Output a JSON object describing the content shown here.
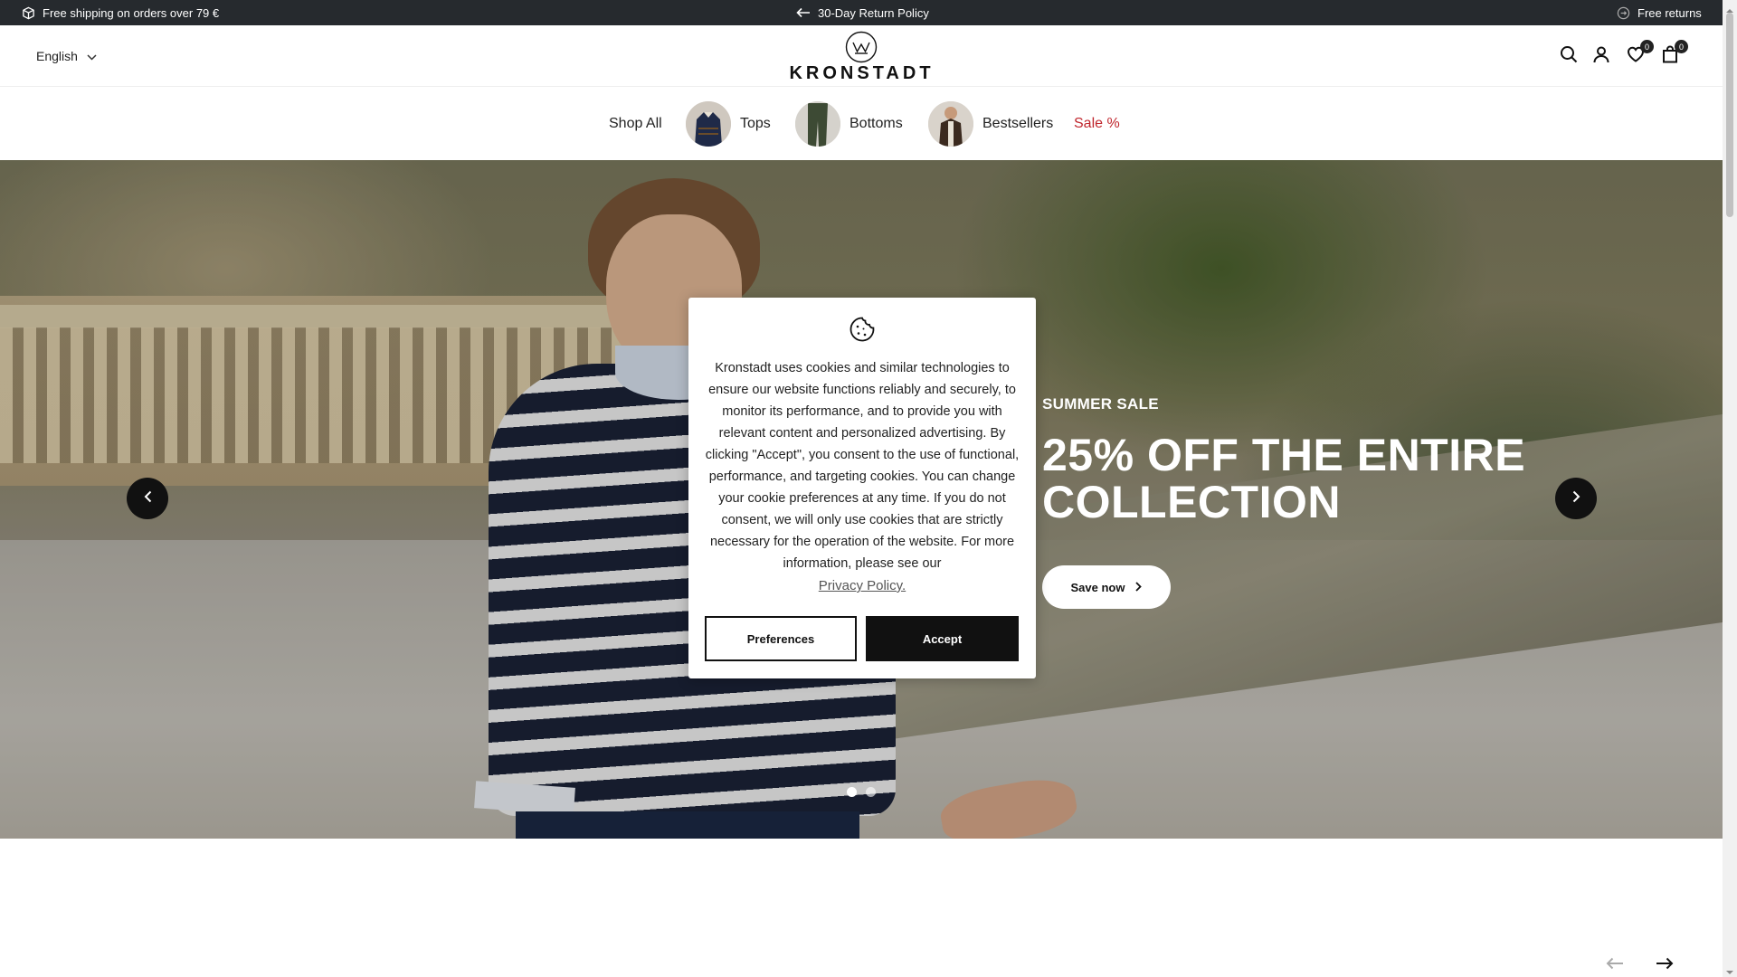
{
  "announcement": {
    "shipping": "Free shipping on orders over 79 €",
    "returns_policy": "30-Day Return Policy",
    "free_returns": "Free returns"
  },
  "header": {
    "language": "English",
    "brand": "KRONSTADT",
    "wishlist_count": "0",
    "cart_count": "0"
  },
  "nav": {
    "items": [
      {
        "label": "Shop All"
      },
      {
        "label": "Tops"
      },
      {
        "label": "Bottoms"
      },
      {
        "label": "Bestsellers"
      },
      {
        "label": "Sale %"
      }
    ],
    "sale_color": "#c0262d"
  },
  "hero": {
    "eyebrow": "SUMMER SALE",
    "headline_line1": "25% OFF THE ENTIRE",
    "headline_line2": "COLLECTION",
    "cta": "Save now",
    "slide_count": 2,
    "active_slide": 1
  },
  "cookie": {
    "text": "Kronstadt uses cookies and similar technologies to ensure our website functions reliably and securely, to monitor its performance, and to provide you with relevant content and personalized advertising. By clicking \"Accept\", you consent to the use of functional, performance, and targeting cookies. You can change your cookie preferences at any time. If you do not consent, we will only use cookies that are strictly necessary for the operation of the website. For more information, please see our",
    "privacy_link": "Privacy Policy.",
    "preferences_button": "Preferences",
    "accept_button": "Accept"
  },
  "colors": {
    "topbar": "#262a2e",
    "accent": "#111111"
  }
}
